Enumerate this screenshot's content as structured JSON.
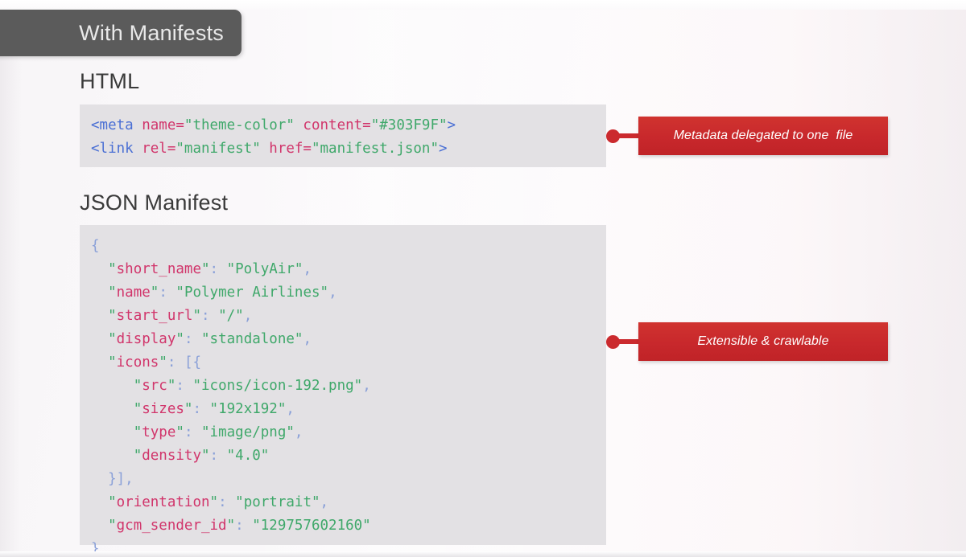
{
  "slide": {
    "title": "With Manifests",
    "background_color": "#faf8fa",
    "tab_color": "#5b5b5b",
    "accent_color": "#cb2a2e",
    "code_bg_color": "#e3e1e4"
  },
  "sections": {
    "html": {
      "heading": "HTML",
      "code_lines": [
        [
          {
            "t": "<meta ",
            "c": "tag"
          },
          {
            "t": "name=",
            "c": "attr"
          },
          {
            "t": "\"theme-color\"",
            "c": "str"
          },
          {
            "t": " ",
            "c": "plain"
          },
          {
            "t": "content=",
            "c": "attr"
          },
          {
            "t": "\"#303F9F\"",
            "c": "str"
          },
          {
            "t": ">",
            "c": "tag"
          }
        ],
        [
          {
            "t": "<link ",
            "c": "tag"
          },
          {
            "t": "rel=",
            "c": "attr"
          },
          {
            "t": "\"manifest\"",
            "c": "str"
          },
          {
            "t": " ",
            "c": "plain"
          },
          {
            "t": "href=",
            "c": "attr"
          },
          {
            "t": "\"manifest.json\"",
            "c": "str"
          },
          {
            "t": ">",
            "c": "tag"
          }
        ]
      ]
    },
    "json": {
      "heading": "JSON Manifest",
      "code_lines": [
        [
          {
            "t": "{",
            "c": "brace"
          }
        ],
        [
          {
            "t": "  ",
            "c": "plain"
          },
          {
            "t": "\"",
            "c": "quote"
          },
          {
            "t": "short_name",
            "c": "key"
          },
          {
            "t": "\"",
            "c": "quote"
          },
          {
            "t": ": ",
            "c": "brace"
          },
          {
            "t": "\"PolyAir\"",
            "c": "str"
          },
          {
            "t": ",",
            "c": "brace"
          }
        ],
        [
          {
            "t": "  ",
            "c": "plain"
          },
          {
            "t": "\"",
            "c": "quote"
          },
          {
            "t": "name",
            "c": "key"
          },
          {
            "t": "\"",
            "c": "quote"
          },
          {
            "t": ": ",
            "c": "brace"
          },
          {
            "t": "\"Polymer Airlines\"",
            "c": "str"
          },
          {
            "t": ",",
            "c": "brace"
          }
        ],
        [
          {
            "t": "  ",
            "c": "plain"
          },
          {
            "t": "\"",
            "c": "quote"
          },
          {
            "t": "start_url",
            "c": "key"
          },
          {
            "t": "\"",
            "c": "quote"
          },
          {
            "t": ": ",
            "c": "brace"
          },
          {
            "t": "\"/\"",
            "c": "str"
          },
          {
            "t": ",",
            "c": "brace"
          }
        ],
        [
          {
            "t": "  ",
            "c": "plain"
          },
          {
            "t": "\"",
            "c": "quote"
          },
          {
            "t": "display",
            "c": "key"
          },
          {
            "t": "\"",
            "c": "quote"
          },
          {
            "t": ": ",
            "c": "brace"
          },
          {
            "t": "\"standalone\"",
            "c": "str"
          },
          {
            "t": ",",
            "c": "brace"
          }
        ],
        [
          {
            "t": "  ",
            "c": "plain"
          },
          {
            "t": "\"",
            "c": "quote"
          },
          {
            "t": "icons",
            "c": "key"
          },
          {
            "t": "\"",
            "c": "quote"
          },
          {
            "t": ": ",
            "c": "brace"
          },
          {
            "t": "[{",
            "c": "brace"
          }
        ],
        [
          {
            "t": "     ",
            "c": "plain"
          },
          {
            "t": "\"",
            "c": "quote"
          },
          {
            "t": "src",
            "c": "key"
          },
          {
            "t": "\"",
            "c": "quote"
          },
          {
            "t": ": ",
            "c": "brace"
          },
          {
            "t": "\"icons/icon-192.png\"",
            "c": "str"
          },
          {
            "t": ",",
            "c": "brace"
          }
        ],
        [
          {
            "t": "     ",
            "c": "plain"
          },
          {
            "t": "\"",
            "c": "quote"
          },
          {
            "t": "sizes",
            "c": "key"
          },
          {
            "t": "\"",
            "c": "quote"
          },
          {
            "t": ": ",
            "c": "brace"
          },
          {
            "t": "\"192x192\"",
            "c": "str"
          },
          {
            "t": ",",
            "c": "brace"
          }
        ],
        [
          {
            "t": "     ",
            "c": "plain"
          },
          {
            "t": "\"",
            "c": "quote"
          },
          {
            "t": "type",
            "c": "key"
          },
          {
            "t": "\"",
            "c": "quote"
          },
          {
            "t": ": ",
            "c": "brace"
          },
          {
            "t": "\"image/png\"",
            "c": "str"
          },
          {
            "t": ",",
            "c": "brace"
          }
        ],
        [
          {
            "t": "     ",
            "c": "plain"
          },
          {
            "t": "\"",
            "c": "quote"
          },
          {
            "t": "density",
            "c": "key"
          },
          {
            "t": "\"",
            "c": "quote"
          },
          {
            "t": ": ",
            "c": "brace"
          },
          {
            "t": "\"4.0\"",
            "c": "str"
          }
        ],
        [
          {
            "t": "  ",
            "c": "plain"
          },
          {
            "t": "}],",
            "c": "brace"
          }
        ],
        [
          {
            "t": "  ",
            "c": "plain"
          },
          {
            "t": "\"",
            "c": "quote"
          },
          {
            "t": "orientation",
            "c": "key"
          },
          {
            "t": "\"",
            "c": "quote"
          },
          {
            "t": ": ",
            "c": "brace"
          },
          {
            "t": "\"portrait\"",
            "c": "str"
          },
          {
            "t": ",",
            "c": "brace"
          }
        ],
        [
          {
            "t": "  ",
            "c": "plain"
          },
          {
            "t": "\"",
            "c": "quote"
          },
          {
            "t": "gcm_sender_id",
            "c": "key"
          },
          {
            "t": "\"",
            "c": "quote"
          },
          {
            "t": ": ",
            "c": "brace"
          },
          {
            "t": "\"129757602160\"",
            "c": "str"
          }
        ],
        [
          {
            "t": "}",
            "c": "brace"
          }
        ]
      ]
    }
  },
  "callouts": [
    {
      "label": "Metadata delegated to one  file"
    },
    {
      "label": "Extensible & crawlable"
    }
  ]
}
